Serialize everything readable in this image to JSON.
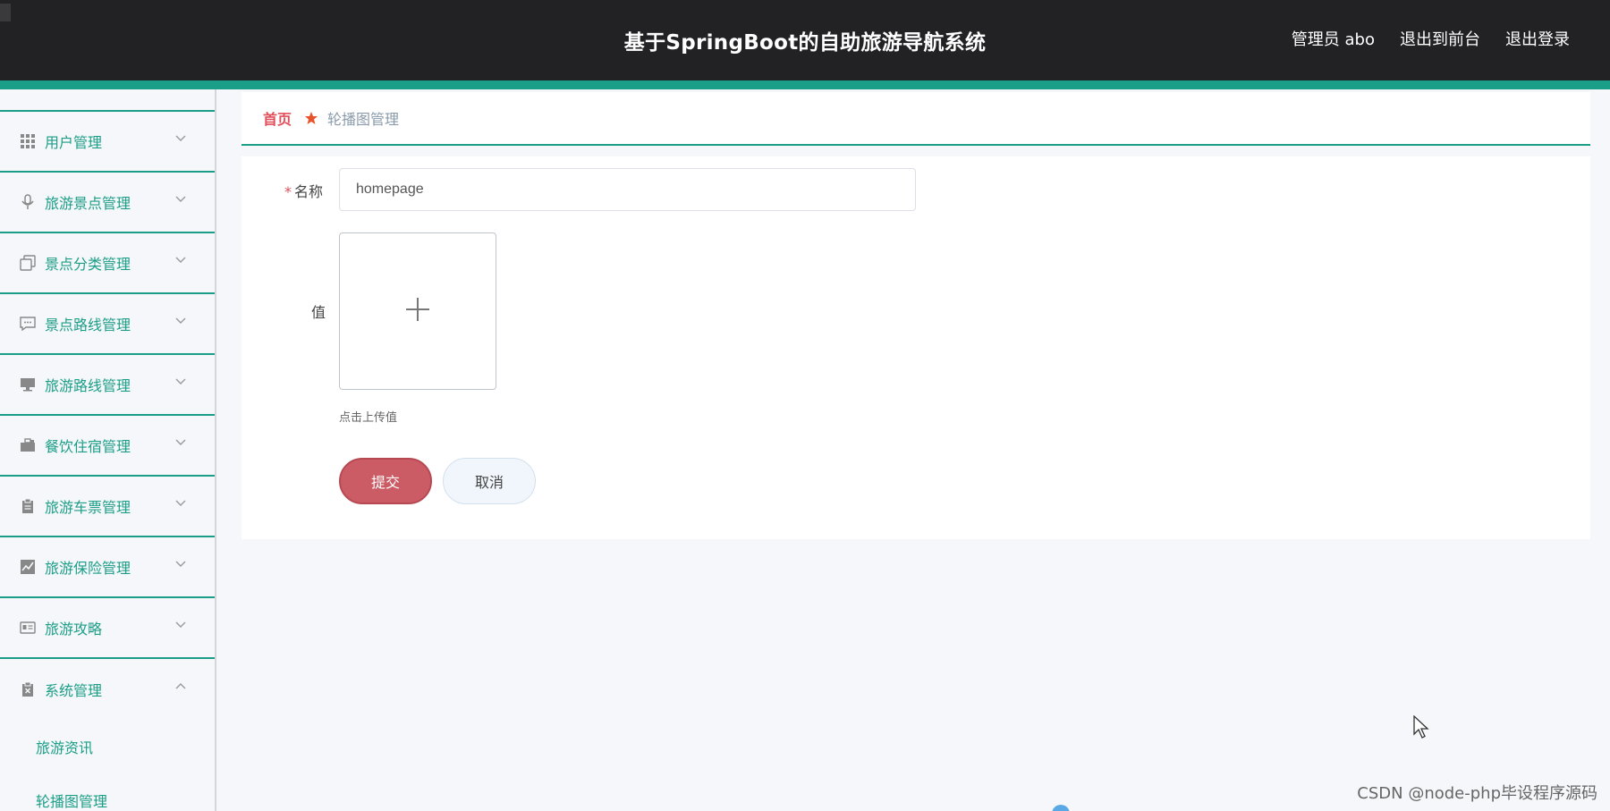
{
  "header": {
    "app_title": "基于SpringBoot的自助旅游导航系统",
    "user_label": "管理员 abo",
    "to_frontend": "退出到前台",
    "logout": "退出登录"
  },
  "sidebar": {
    "items": [
      {
        "label": "用户管理",
        "icon": "grid-icon"
      },
      {
        "label": "旅游景点管理",
        "icon": "microphone-icon"
      },
      {
        "label": "景点分类管理",
        "icon": "copy-icon"
      },
      {
        "label": "景点路线管理",
        "icon": "chat-icon"
      },
      {
        "label": "旅游路线管理",
        "icon": "monitor-icon"
      },
      {
        "label": "餐饮住宿管理",
        "icon": "briefcase-icon"
      },
      {
        "label": "旅游车票管理",
        "icon": "clipboard-icon"
      },
      {
        "label": "旅游保险管理",
        "icon": "chart-icon"
      },
      {
        "label": "旅游攻略",
        "icon": "id-card-icon"
      },
      {
        "label": "系统管理",
        "icon": "clipboard-x-icon"
      }
    ],
    "subitems": [
      {
        "label": "旅游资讯"
      },
      {
        "label": "轮播图管理"
      }
    ]
  },
  "breadcrumb": {
    "home": "首页",
    "current": "轮播图管理"
  },
  "form": {
    "name_label": "名称",
    "name_value": "homepage",
    "value_label": "值",
    "upload_hint": "点击上传值",
    "submit_label": "提交",
    "cancel_label": "取消"
  },
  "watermark": "CSDN @node-php毕设程序源码",
  "colors": {
    "accent": "#1b9e87",
    "header_bg": "#222224",
    "submit": "#cb5c65",
    "breadcrumb_home": "#e04e5a"
  }
}
